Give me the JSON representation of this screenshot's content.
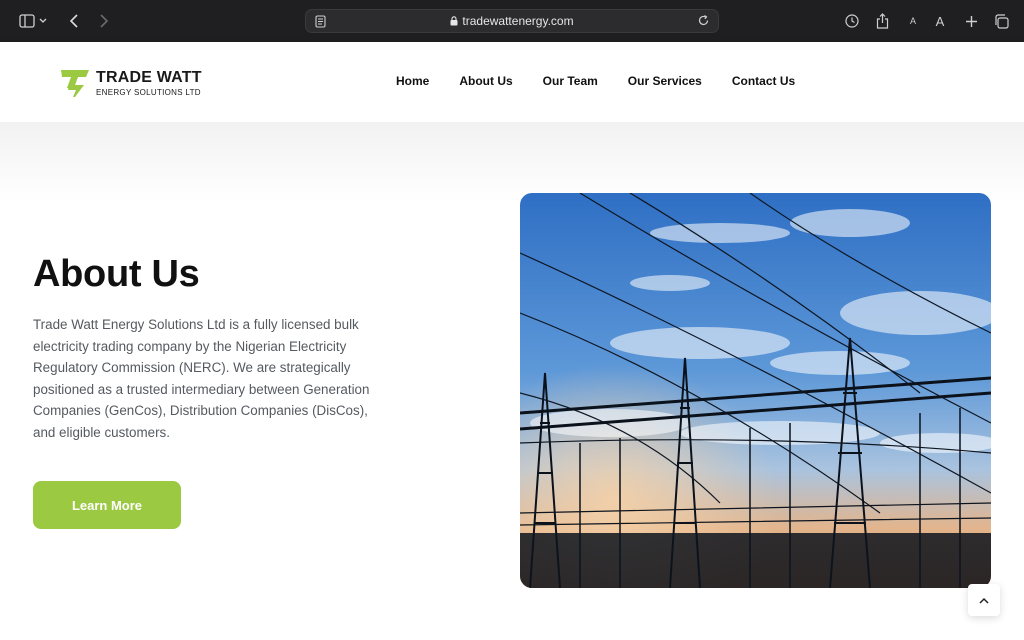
{
  "browser": {
    "url": "tradewattenergy.com"
  },
  "brand": {
    "name": "TRADE WATT",
    "tagline": "ENERGY SOLUTIONS LTD",
    "accent_color": "#9bc942"
  },
  "nav": {
    "items": [
      "Home",
      "About Us",
      "Our Team",
      "Our Services",
      "Contact Us"
    ]
  },
  "hero": {
    "title": "About Us",
    "body": "Trade Watt Energy Solutions Ltd is a fully licensed bulk electricity trading company by the Nigerian Electricity Regulatory Commission (NERC). We are strategically positioned as a trusted intermediary between Generation Companies (GenCos), Distribution Companies (DisCos), and eligible customers.",
    "button_label": "Learn More"
  },
  "icons": {
    "sidebar": "sidebar-icon",
    "back": "chevron-left-icon",
    "forward": "chevron-right-icon",
    "lock": "lock-icon",
    "reload": "reload-icon",
    "history": "clock-icon",
    "share": "share-icon",
    "new_tab": "plus-icon",
    "tabs": "tabs-icon",
    "scroll_top": "chevron-up-icon"
  }
}
